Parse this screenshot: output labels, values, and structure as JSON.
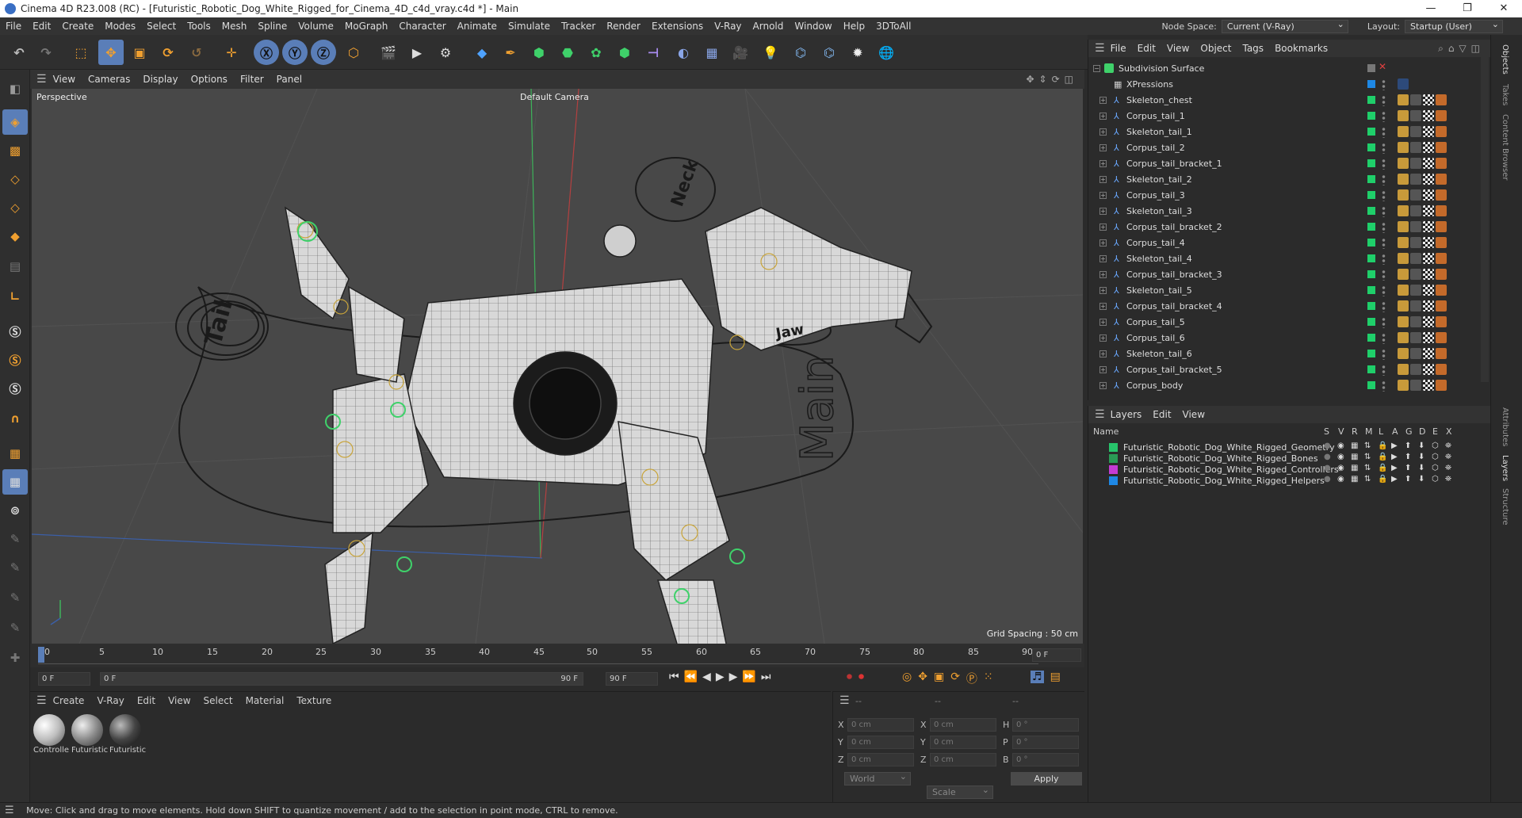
{
  "window": {
    "title": "Cinema 4D R23.008 (RC) - [Futuristic_Robotic_Dog_White_Rigged_for_Cinema_4D_c4d_vray.c4d *] - Main",
    "controls": [
      "—",
      "❐",
      "✕"
    ]
  },
  "menubar": {
    "items": [
      "File",
      "Edit",
      "Create",
      "Modes",
      "Select",
      "Tools",
      "Mesh",
      "Spline",
      "Volume",
      "MoGraph",
      "Character",
      "Animate",
      "Simulate",
      "Tracker",
      "Render",
      "Extensions",
      "V-Ray",
      "Arnold",
      "Window",
      "Help",
      "3DToAll"
    ],
    "node_space_label": "Node Space:",
    "node_space_value": "Current (V-Ray)",
    "layout_label": "Layout:",
    "layout_value": "Startup (User)"
  },
  "viewport": {
    "menu": [
      "View",
      "Cameras",
      "Display",
      "Options",
      "Filter",
      "Panel"
    ],
    "label": "Perspective",
    "camera": "Default Camera",
    "grid_spacing": "Grid Spacing : 50 cm",
    "annotations": [
      "Tail",
      "Neck",
      "Jaw",
      "Main"
    ]
  },
  "timeline": {
    "ticks": [
      "0",
      "5",
      "10",
      "15",
      "20",
      "25",
      "30",
      "35",
      "40",
      "45",
      "50",
      "55",
      "60",
      "65",
      "70",
      "75",
      "80",
      "85",
      "90"
    ],
    "current_frame": "0 F"
  },
  "transport": {
    "start": "0 F",
    "range_start": "0 F",
    "range_end": "90 F",
    "end": "90 F"
  },
  "materials": {
    "menu": [
      "Create",
      "V-Ray",
      "Edit",
      "View",
      "Select",
      "Material",
      "Texture"
    ],
    "items": [
      {
        "label": "Controlle",
        "color": "#bdbdbd"
      },
      {
        "label": "Futuristic",
        "color": "#8a8a8a"
      },
      {
        "label": "Futuristic",
        "color": "#444444"
      }
    ]
  },
  "coordinates": {
    "header": [
      "--",
      "--",
      "--"
    ],
    "rows": [
      {
        "a": "X",
        "av": "0 cm",
        "b": "X",
        "bv": "0 cm",
        "c": "H",
        "cv": "0 °"
      },
      {
        "a": "Y",
        "av": "0 cm",
        "b": "Y",
        "bv": "0 cm",
        "c": "P",
        "cv": "0 °"
      },
      {
        "a": "Z",
        "av": "0 cm",
        "b": "Z",
        "bv": "0 cm",
        "c": "B",
        "cv": "0 °"
      }
    ],
    "space": "World",
    "mode": "Scale",
    "apply": "Apply"
  },
  "objects": {
    "menu": [
      "File",
      "Edit",
      "View",
      "Object",
      "Tags",
      "Bookmarks"
    ],
    "root": "Subdivision Surface",
    "items": [
      {
        "name": "XPressions",
        "vis": "#1e88e5"
      },
      {
        "name": "Skeleton_chest",
        "vis": "#1fcf6a"
      },
      {
        "name": "Corpus_tail_1",
        "vis": "#1fcf6a"
      },
      {
        "name": "Skeleton_tail_1",
        "vis": "#1fcf6a"
      },
      {
        "name": "Corpus_tail_2",
        "vis": "#1fcf6a"
      },
      {
        "name": "Corpus_tail_bracket_1",
        "vis": "#1fcf6a"
      },
      {
        "name": "Skeleton_tail_2",
        "vis": "#1fcf6a"
      },
      {
        "name": "Corpus_tail_3",
        "vis": "#1fcf6a"
      },
      {
        "name": "Skeleton_tail_3",
        "vis": "#1fcf6a"
      },
      {
        "name": "Corpus_tail_bracket_2",
        "vis": "#1fcf6a"
      },
      {
        "name": "Corpus_tail_4",
        "vis": "#1fcf6a"
      },
      {
        "name": "Skeleton_tail_4",
        "vis": "#1fcf6a"
      },
      {
        "name": "Corpus_tail_bracket_3",
        "vis": "#1fcf6a"
      },
      {
        "name": "Skeleton_tail_5",
        "vis": "#1fcf6a"
      },
      {
        "name": "Corpus_tail_bracket_4",
        "vis": "#1fcf6a"
      },
      {
        "name": "Corpus_tail_5",
        "vis": "#1fcf6a"
      },
      {
        "name": "Corpus_tail_6",
        "vis": "#1fcf6a"
      },
      {
        "name": "Skeleton_tail_6",
        "vis": "#1fcf6a"
      },
      {
        "name": "Corpus_tail_bracket_5",
        "vis": "#1fcf6a"
      },
      {
        "name": "Corpus_body",
        "vis": "#1fcf6a"
      }
    ]
  },
  "layers": {
    "menu": [
      "Layers",
      "Edit",
      "View"
    ],
    "columns": [
      "Name",
      "S",
      "V",
      "R",
      "M",
      "L",
      "A",
      "G",
      "D",
      "E",
      "X"
    ],
    "items": [
      {
        "name": "Futuristic_Robotic_Dog_White_Rigged_Geometry",
        "color": "#27c46b"
      },
      {
        "name": "Futuristic_Robotic_Dog_White_Rigged_Bones",
        "color": "#2a9a55"
      },
      {
        "name": "Futuristic_Robotic_Dog_White_Rigged_Controllers",
        "color": "#c43bd4"
      },
      {
        "name": "Futuristic_Robotic_Dog_White_Rigged_Helpers",
        "color": "#1e88e5"
      }
    ]
  },
  "side_tabs": [
    "Objects",
    "Takes",
    "Content Browser",
    "Attributes",
    "Layers",
    "Structure"
  ],
  "status": "Move: Click and drag to move elements. Hold down SHIFT to quantize movement / add to the selection in point mode, CTRL to remove."
}
